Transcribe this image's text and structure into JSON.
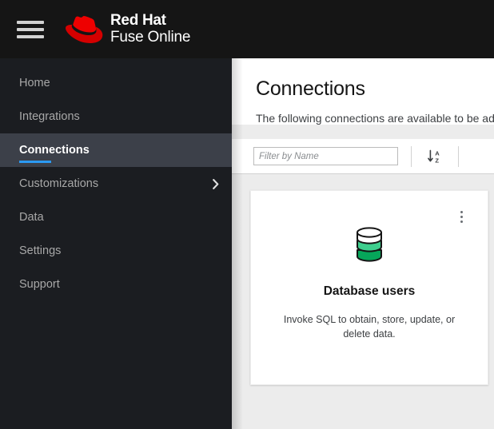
{
  "masthead": {
    "menu_toggle_label": "Toggle navigation",
    "brand_line1": "Red Hat",
    "brand_line2": "Fuse Online"
  },
  "sidebar": {
    "items": [
      {
        "label": "Home",
        "active": false,
        "has_chevron": false
      },
      {
        "label": "Integrations",
        "active": false,
        "has_chevron": false
      },
      {
        "label": "Connections",
        "active": true,
        "has_chevron": false
      },
      {
        "label": "Customizations",
        "active": false,
        "has_chevron": true
      },
      {
        "label": "Data",
        "active": false,
        "has_chevron": false
      },
      {
        "label": "Settings",
        "active": false,
        "has_chevron": false
      },
      {
        "label": "Support",
        "active": false,
        "has_chevron": false
      }
    ]
  },
  "page": {
    "title": "Connections",
    "subtitle": "The following connections are available to be add"
  },
  "toolbar": {
    "filter_placeholder": "Filter by Name",
    "filter_value": "",
    "sort_label": "Sort A to Z"
  },
  "cards": [
    {
      "title": "Database users",
      "description": "Invoke SQL to obtain, store, update, or delete data.",
      "icon": "database-icon",
      "menu_label": "Card actions"
    }
  ],
  "colors": {
    "masthead_bg": "#151515",
    "sidebar_bg": "#1b1d21",
    "sidebar_active_bg": "#3c4049",
    "accent_blue": "#2b9af3",
    "brand_red": "#ee0000",
    "content_bg": "#ececec",
    "db_green_light": "#3ecf8e",
    "db_green_dark": "#06a65a"
  }
}
